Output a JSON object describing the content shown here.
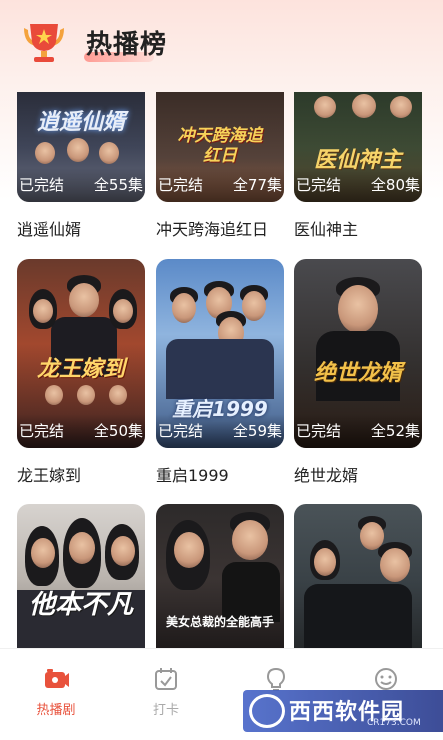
{
  "header": {
    "title": "热播榜"
  },
  "dramas": [
    {
      "title": "逍遥仙婿",
      "status": "已完结",
      "episodes": "全55集",
      "art": "逍遥仙婿"
    },
    {
      "title": "冲天跨海追红日",
      "status": "已完结",
      "episodes": "全77集",
      "art": "冲天跨海追红日"
    },
    {
      "title": "医仙神主",
      "status": "已完结",
      "episodes": "全80集",
      "art": "医仙神主"
    },
    {
      "title": "龙王嫁到",
      "status": "已完结",
      "episodes": "全50集",
      "art": "龙王嫁到"
    },
    {
      "title": "重启1999",
      "status": "已完结",
      "episodes": "全59集",
      "art": "重启1999"
    },
    {
      "title": "绝世龙婿",
      "status": "已完结",
      "episodes": "全52集",
      "art": "绝世龙婿"
    },
    {
      "title": "",
      "status": "",
      "episodes": "",
      "art": "他本不凡"
    },
    {
      "title": "",
      "status": "",
      "episodes": "",
      "art": "美女总裁的全能高手"
    },
    {
      "title": "",
      "status": "",
      "episodes": "",
      "art": ""
    }
  ],
  "tabbar": {
    "tabs": [
      {
        "label": "热播剧",
        "icon": "tv-icon",
        "active": true
      },
      {
        "label": "打卡",
        "icon": "calendar-check-icon",
        "active": false
      },
      {
        "label": "",
        "icon": "lightbulb-icon",
        "active": false
      },
      {
        "label": "",
        "icon": "smile-icon",
        "active": false
      }
    ]
  },
  "watermark": {
    "brand": "西西软件园",
    "domain": "CR173.COM"
  },
  "colors": {
    "accent": "#e8523c",
    "text": "#222222",
    "tab_inactive": "#aaaaaa"
  }
}
